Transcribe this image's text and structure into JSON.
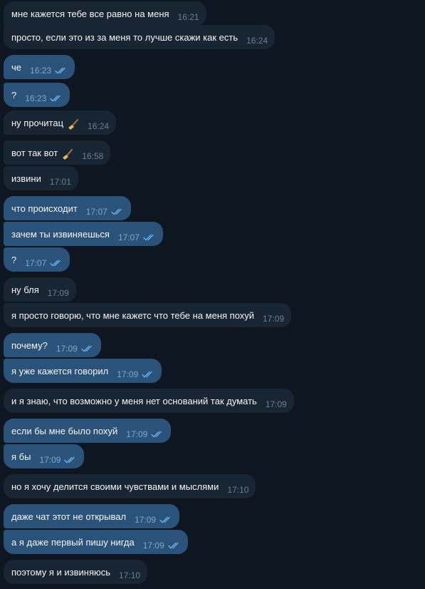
{
  "colors": {
    "background": "#0e1621",
    "incoming_bubble": "#182533",
    "outgoing_bubble": "#2b5278",
    "text": "#f5f5f5",
    "incoming_time": "#6d7f8f",
    "outgoing_time": "#7da8d3",
    "read_check": "#6ab3f3"
  },
  "messages": [
    {
      "dir": "in",
      "text": "мне кажется тебе все равно на меня",
      "time": "16:21"
    },
    {
      "dir": "in",
      "text": "просто, если это из за меня то лучше скажи как есть",
      "time": "16:24"
    },
    {
      "dir": "out",
      "text": "че",
      "time": "16:23",
      "read": true
    },
    {
      "dir": "out",
      "text": "?",
      "time": "16:23",
      "read": true
    },
    {
      "dir": "in",
      "text": "ну прочитац",
      "time": "16:24",
      "icon": "broom-icon"
    },
    {
      "dir": "in",
      "text": "вот так вот",
      "time": "16:58",
      "icon": "broom-icon"
    },
    {
      "dir": "in",
      "text": "извини",
      "time": "17:01"
    },
    {
      "dir": "out",
      "text": "что происходит",
      "time": "17:07",
      "read": true
    },
    {
      "dir": "out",
      "text": "зачем ты извиняешься",
      "time": "17:07",
      "read": true
    },
    {
      "dir": "out",
      "text": "?",
      "time": "17:07",
      "read": true
    },
    {
      "dir": "in",
      "text": "ну бля",
      "time": "17:09"
    },
    {
      "dir": "in",
      "text": "я просто говорю, что мне кажетс что тебе на меня похуй",
      "time": "17:09"
    },
    {
      "dir": "out",
      "text": "почему?",
      "time": "17:09",
      "read": true
    },
    {
      "dir": "out",
      "text": "я уже кажется говорил",
      "time": "17:09",
      "read": true
    },
    {
      "dir": "in",
      "text": "и я знаю, что возможно у меня нет оснований так думать",
      "time": "17:09"
    },
    {
      "dir": "out",
      "text": "если бы мне было похуй",
      "time": "17:09",
      "read": true
    },
    {
      "dir": "out",
      "text": "я бы",
      "time": "17:09",
      "read": true
    },
    {
      "dir": "in",
      "text": "но я хочу делится своими чувствами и мыслями",
      "time": "17:10"
    },
    {
      "dir": "out",
      "text": "даже чат этот не открывал",
      "time": "17:09",
      "read": true
    },
    {
      "dir": "out",
      "text": "а я даже первый пишу нигда",
      "time": "17:09",
      "read": true
    },
    {
      "dir": "in",
      "text": "поэтому я и извиняюсь",
      "time": "17:10"
    }
  ]
}
